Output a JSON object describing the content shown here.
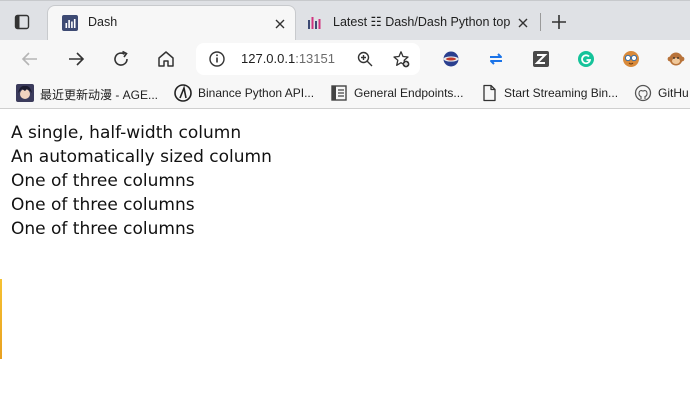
{
  "browser": {
    "tabs": [
      {
        "title": "Dash",
        "active": true
      },
      {
        "title": "Latest ☷ Dash/Dash Python top",
        "active": false
      }
    ],
    "address": {
      "host": "127.0.0.1",
      "port": ":13151"
    },
    "bookmarks": [
      {
        "label": "最近更新动漫 - AGE..."
      },
      {
        "label": "Binance Python API..."
      },
      {
        "label": "General Endpoints..."
      },
      {
        "label": "Start Streaming Bin..."
      },
      {
        "label": "GitHu"
      }
    ]
  },
  "page": {
    "lines": [
      "A single, half-width column",
      "An automatically sized column",
      "One of three columns",
      "One of three columns",
      "One of three columns"
    ]
  },
  "colors": {
    "tab_strip": "#dfe1e5",
    "toolbar": "#f7f7f7",
    "dash_icon": "#3d4a73"
  }
}
